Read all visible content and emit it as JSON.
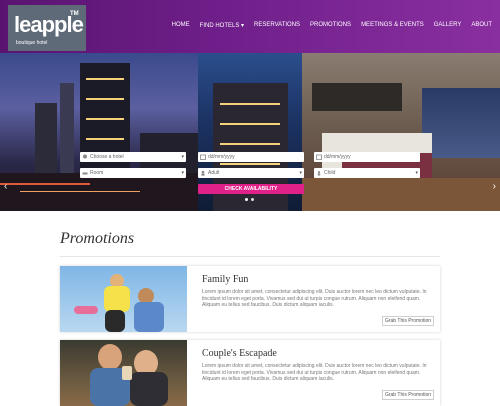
{
  "brand": {
    "name": "leapple",
    "tm": "TM",
    "tagline": "boutique hotel"
  },
  "nav": [
    {
      "label": "HOME"
    },
    {
      "label": "FIND HOTELS ▾"
    },
    {
      "label": "RESERVATIONS"
    },
    {
      "label": "PROMOTIONS"
    },
    {
      "label": "MEETINGS & EVENTS"
    },
    {
      "label": "GALLERY"
    },
    {
      "label": "ABOUT"
    }
  ],
  "booking": {
    "hotel_placeholder": "Choose a hotel",
    "checkin_placeholder": "dd/mm/yyyy",
    "checkout_placeholder": "dd/mm/yyyy",
    "room_value": "Room",
    "adult_value": "Adult",
    "child_value": "Child",
    "submit_label": "CHECK AVAILABILITY"
  },
  "hero": {
    "arrow_left": "‹",
    "arrow_right": "›"
  },
  "promotions": {
    "heading": "Promotions",
    "cards": [
      {
        "title": "Family Fun",
        "description": "Lorem ipsum dolor sit amet, consectetur adipiscing elit. Duis auctor lorem nec leo dictum vulputate. In tincidunt id lorem eget porta. Vivamus sed dui ut turpis congue rutrum. Aliquam non eleifend quam. Aliquam eu tellus sed faucibus. Duis dictum aliquam iaculis.",
        "button": "Grab This Promotion"
      },
      {
        "title": "Couple's Escapade",
        "description": "Lorem ipsum dolor sit amet, consectetur adipiscing elit. Duis auctor lorem nec leo dictum vulputate. In tincidunt id lorem eget porta. Vivamus sed dui ut turpis congue rutrum. Aliquam non eleifend quam. Aliquam eu tellus sed faucibus. Duis dictum aliquam iaculis.",
        "button": "Grab This Promotion"
      }
    ]
  },
  "colors": {
    "header": "#6f1f8a",
    "accent": "#e0218a"
  }
}
